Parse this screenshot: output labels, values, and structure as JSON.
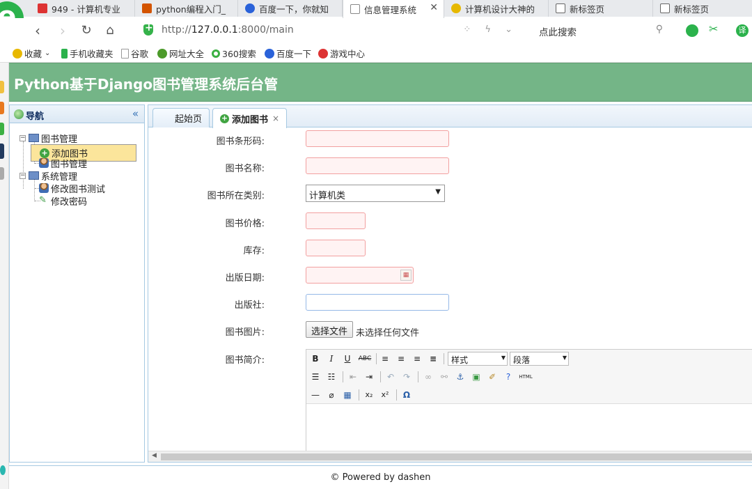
{
  "browser": {
    "tabs": [
      {
        "label": "949 - 计算机专业",
        "color": "#d33"
      },
      {
        "label": "python编程入门_",
        "color": "#d35400"
      },
      {
        "label": "百度一下，你就知",
        "color": "#2a62d9"
      },
      {
        "label": "信息管理系统",
        "color": "#888"
      },
      {
        "label": "计算机设计大神的",
        "color": "#e6b800"
      },
      {
        "label": "新标签页",
        "color": "#666"
      },
      {
        "label": "新标签页",
        "color": "#666"
      }
    ],
    "url_prefix": "http://",
    "url_host": "127.0.0.1",
    "url_rest": ":8000/main",
    "search_placeholder": "点此搜索",
    "translate_label": "译",
    "bookmarks": [
      {
        "label": "收藏",
        "color": "#e8b800"
      },
      {
        "label": "手机收藏夹",
        "color": "#2bb24c"
      },
      {
        "label": "谷歌",
        "color": "#999"
      },
      {
        "label": "网址大全",
        "color": "#4c9a2a"
      },
      {
        "label": "360搜索",
        "color": "#3cb043"
      },
      {
        "label": "百度一下",
        "color": "#2a62d9"
      },
      {
        "label": "游戏中心",
        "color": "#d33"
      }
    ]
  },
  "app": {
    "title": "Python基于Django图书管理系统后台管",
    "nav_title": "导航",
    "tree": [
      "图书管理",
      "添加图书",
      "图书管理",
      "系统管理",
      "修改图书测试",
      "修改密码"
    ],
    "tabs": [
      "起始页",
      "添加图书"
    ],
    "form": {
      "barcode_label": "图书条形码:",
      "name_label": "图书名称:",
      "category_label": "图书所在类别:",
      "category_value": "计算机类",
      "price_label": "图书价格:",
      "stock_label": "库存:",
      "date_label": "出版日期:",
      "publisher_label": "出版社:",
      "image_label": "图书图片:",
      "file_button": "选择文件",
      "file_status": "未选择任何文件",
      "intro_label": "图书简介:",
      "style_dropdown": "样式",
      "paragraph_dropdown": "段落"
    },
    "footer": "© Powered by dashen"
  }
}
